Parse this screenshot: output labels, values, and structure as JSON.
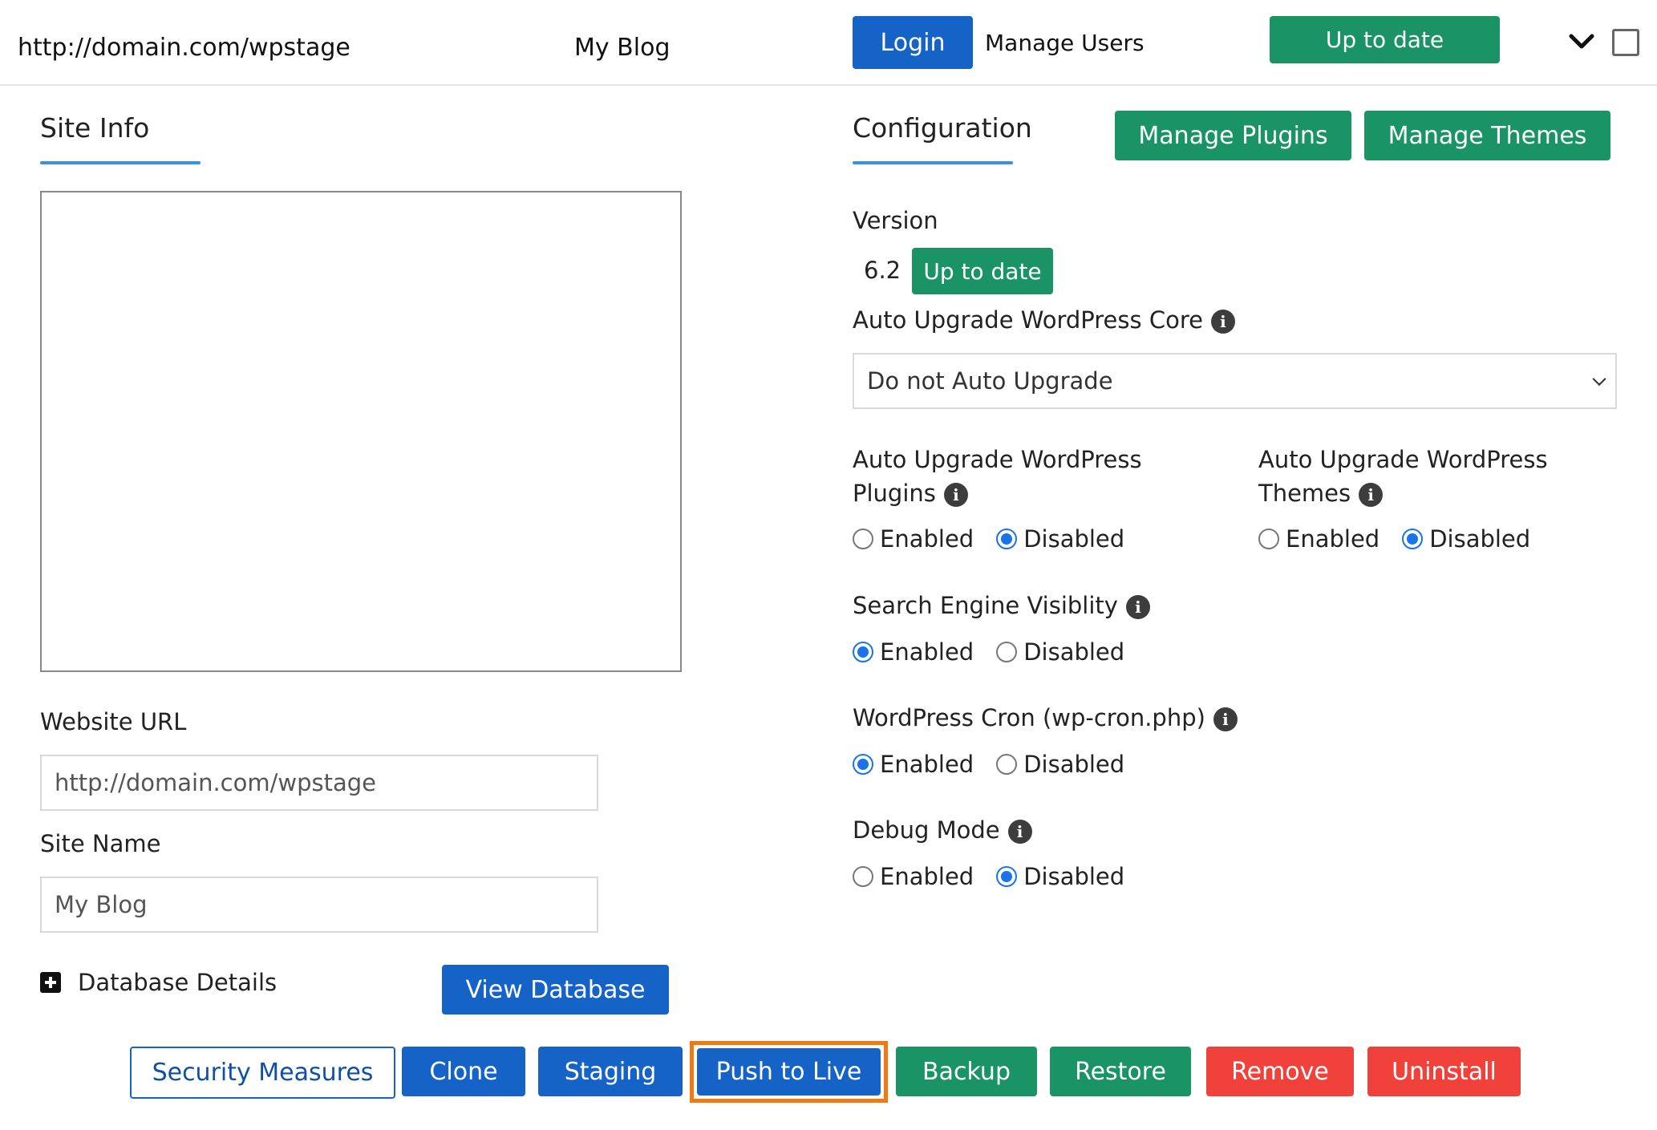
{
  "header": {
    "url": "http://domain.com/wpstage",
    "site_name": "My Blog",
    "login_label": "Login",
    "manage_users_label": "Manage Users",
    "status_label": "Up to date"
  },
  "site_info": {
    "title": "Site Info",
    "website_url_label": "Website URL",
    "website_url_value": "http://domain.com/wpstage",
    "site_name_label": "Site Name",
    "site_name_value": "My Blog",
    "database_details_label": "Database Details",
    "view_database_label": "View Database"
  },
  "configuration": {
    "title": "Configuration",
    "manage_plugins_label": "Manage Plugins",
    "manage_themes_label": "Manage Themes",
    "version_label": "Version",
    "version_value": "6.2",
    "version_status": "Up to date",
    "auto_upgrade_core_label": "Auto Upgrade WordPress Core",
    "auto_upgrade_core_value": "Do not Auto Upgrade",
    "auto_upgrade_plugins_label_line1": "Auto Upgrade WordPress",
    "auto_upgrade_plugins_label_line2": "Plugins",
    "auto_upgrade_themes_label_line1": "Auto Upgrade WordPress",
    "auto_upgrade_themes_label_line2": "Themes",
    "search_engine_label": "Search Engine Visiblity",
    "cron_label": "WordPress Cron (wp-cron.php)",
    "debug_label": "Debug Mode",
    "enabled_label": "Enabled",
    "disabled_label": "Disabled",
    "settings": {
      "auto_upgrade_plugins": "Disabled",
      "auto_upgrade_themes": "Disabled",
      "search_engine_visibility": "Enabled",
      "wp_cron": "Enabled",
      "debug_mode": "Disabled"
    }
  },
  "actions": {
    "security_measures": "Security Measures",
    "clone": "Clone",
    "staging": "Staging",
    "push_to_live": "Push to Live",
    "backup": "Backup",
    "restore": "Restore",
    "remove": "Remove",
    "uninstall": "Uninstall"
  },
  "colors": {
    "primary_blue": "#1663c7",
    "success_green": "#1a9465",
    "danger_red": "#f0413a",
    "highlight_orange": "#f07a12",
    "radio_blue": "#1a73e8"
  }
}
